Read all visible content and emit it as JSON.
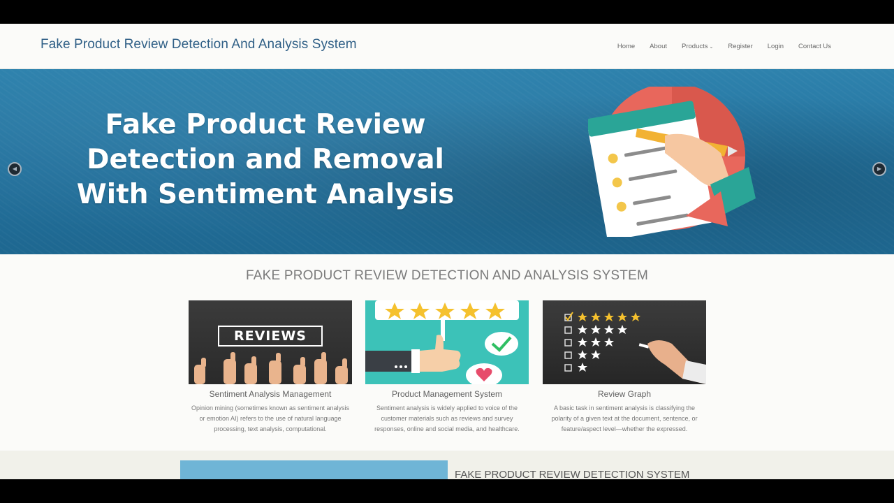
{
  "header": {
    "brand": "Fake Product Review Detection And Analysis System",
    "nav": [
      {
        "label": "Home"
      },
      {
        "label": "About"
      },
      {
        "label": "Products"
      },
      {
        "label": "Register"
      },
      {
        "label": "Login"
      },
      {
        "label": "Contact Us"
      }
    ]
  },
  "hero": {
    "title_lines": [
      "Fake Product Review",
      "Detection and Removal",
      "With Sentiment Analysis"
    ],
    "prev_icon": "chevron-left-icon",
    "next_icon": "chevron-right-icon"
  },
  "section": {
    "title": "FAKE PRODUCT REVIEW DETECTION AND ANALYSIS SYSTEM",
    "cards": [
      {
        "image_text": "REVIEWS",
        "title": "Sentiment Analysis Management",
        "description": "Opinion mining (sometimes known as sentiment analysis or emotion AI) refers to the use of natural language processing, text analysis, computational."
      },
      {
        "image_text": "",
        "title": "Product Management System",
        "description": "Sentiment analysis is widely applied to voice of the customer materials such as reviews and survey responses, online and social media, and healthcare."
      },
      {
        "image_text": "",
        "title": "Review Graph",
        "description": "A basic task in sentiment analysis is classifying the polarity of a given text at the document, sentence, or feature/aspect level—whether the expressed."
      }
    ]
  },
  "band": {
    "title": "FAKE PRODUCT REVIEW DETECTION SYSTEM"
  },
  "colors": {
    "brand": "#2f5f86",
    "hero_bg": "#23729e",
    "band_image": "#6fb5d6"
  }
}
